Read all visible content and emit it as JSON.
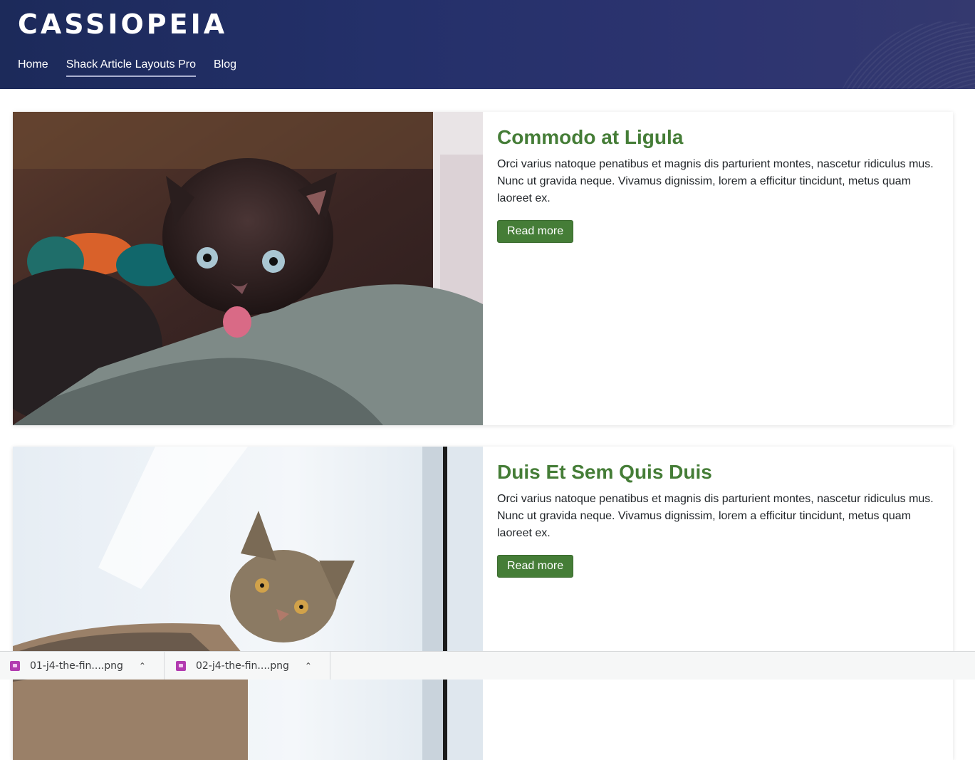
{
  "site": {
    "title": "CASSIOPEIA"
  },
  "nav": {
    "items": [
      {
        "label": "Home"
      },
      {
        "label": "Shack Article Layouts Pro",
        "active": true
      },
      {
        "label": "Blog"
      }
    ]
  },
  "articles": [
    {
      "title": "Commodo at Ligula",
      "body": "Orci varius natoque penatibus et magnis dis parturient montes, nascetur ridiculus mus. Nunc ut gravida neque. Vivamus dignissim, lorem a efficitur tincidunt, metus quam laoreet ex.",
      "read_more": "Read more",
      "image_icon": "kitten-photo"
    },
    {
      "title": "Duis Et Sem Quis Duis",
      "body": "Orci varius natoque penatibus et magnis dis parturient montes, nascetur ridiculus mus. Nunc ut gravida neque. Vivamus dignissim, lorem a efficitur tincidunt, metus quam laoreet ex.",
      "read_more": "Read more",
      "image_icon": "tabby-cat-photo"
    }
  ],
  "downloads": [
    {
      "name": "01-j4-the-fin....png",
      "icon": "image-file-icon"
    },
    {
      "name": "02-j4-the-fin....png",
      "icon": "image-file-icon"
    }
  ],
  "colors": {
    "header": "#24306a",
    "accent": "#457d37",
    "file_icon": "#b23bb0"
  }
}
